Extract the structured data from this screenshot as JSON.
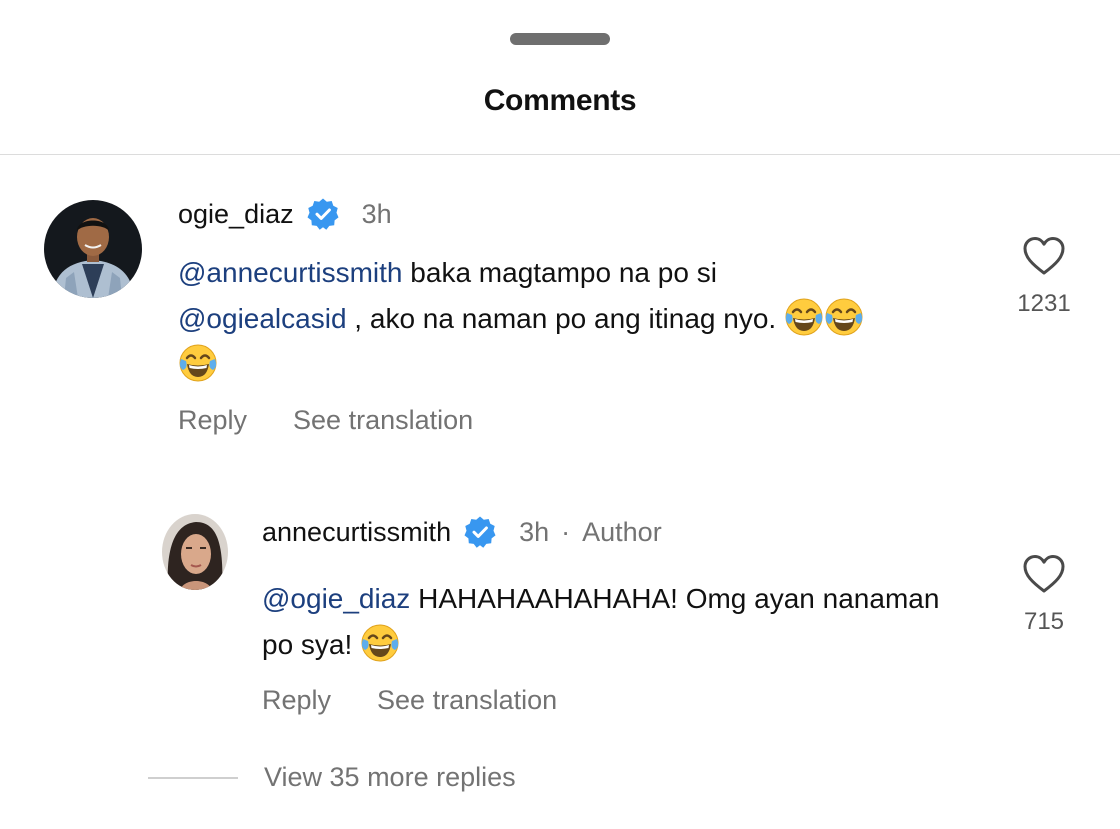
{
  "sheet": {
    "title": "Comments"
  },
  "comments": [
    {
      "username": "ogie_diaz",
      "time": "3h",
      "mention": "@annecurtissmith",
      "text_part1": " baka magtampo na po si",
      "mention2": "@ogiealcasid",
      "text_part2": " , ako na naman po ang itinag nyo.",
      "emoji": "tears-of-joy-emoji",
      "likes": "1231",
      "reply_label": "Reply",
      "translate_label": "See translation"
    },
    {
      "username": "annecurtissmith",
      "time": "3h",
      "separator": "·",
      "badge": "Author",
      "mention": "@ogie_diaz",
      "text_part1": " HAHAHAAHAHAHA! Omg ayan nanaman po sya!",
      "emoji": "tears-of-joy-emoji",
      "likes": "715",
      "reply_label": "Reply",
      "translate_label": "See translation"
    }
  ],
  "view_more": "View 35 more replies",
  "colors": {
    "mention": "#1c3f7e",
    "verified": "#3897f0",
    "muted": "#737373"
  },
  "icons": [
    "verified-badge-icon",
    "heart-icon",
    "tears-of-joy-emoji"
  ]
}
